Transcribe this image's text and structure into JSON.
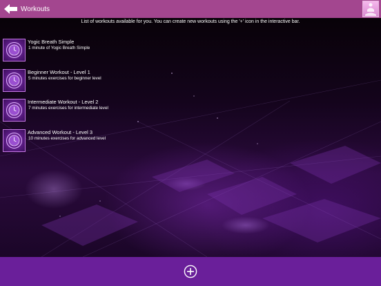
{
  "header": {
    "back_icon": "left-arrow-icon",
    "title": "Workouts",
    "avatar_icon": "meditation-avatar-icon",
    "background_color": "#a3468f"
  },
  "info": {
    "text": "List of workouts available for you. You can create new workouts using the '+' icon in the interactive bar."
  },
  "workouts": [
    {
      "title": "Yogic Breath Simple",
      "description": "1 minute of Yogic Breath Simple",
      "icon": "timer-icon"
    },
    {
      "title": "Beginner Workout - Level 1",
      "description": "5 minutes exercises for beginner level",
      "icon": "timer-icon"
    },
    {
      "title": "Intermediate Workout - Level 2",
      "description": "7 minutes exercises for intermediate level",
      "icon": "timer-icon"
    },
    {
      "title": "Advanced Workout - Level 3",
      "description": "10 minutes exercises for advanced level",
      "icon": "timer-icon"
    }
  ],
  "bottom_bar": {
    "add_icon": "add-circle-icon",
    "background_color": "#6a1f9a"
  },
  "colors": {
    "accent": "#a3468f",
    "bar": "#6a1f9a",
    "icon_border": "#c678e6"
  }
}
